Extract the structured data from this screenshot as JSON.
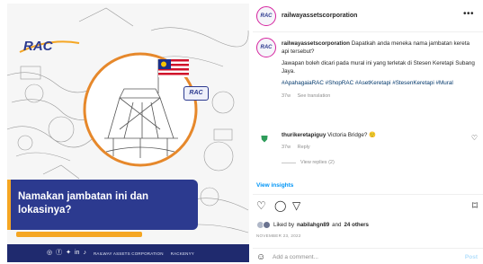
{
  "post_image": {
    "logo_text": "RAC",
    "badge_text": "RAC",
    "caption_text": "Namakan jambatan ini dan lokasinya?",
    "footer_text": "RAILWAY ASSETS CORPORATION",
    "footer_handle": "RACKENYY",
    "colors": {
      "banner": "#2c3a8f",
      "accent": "#f5a623",
      "footer": "#1f2a6e"
    }
  },
  "header": {
    "username": "railwayassetscorporation",
    "avatar_text": "RAC",
    "more_icon": "more-horizontal-icon"
  },
  "caption": {
    "username": "railwayassetscorporation",
    "line1": "Dapatkah anda meneka nama jambatan kereta api tersebut?",
    "line2": "Jawapan boleh dicari pada mural ini yang terletak di Stesen Keretapi Subang Jaya.",
    "hashtags": "#ApahagaiaRAC #ShopRAC #AsetKeretapi #StesenKeretapi #Mural",
    "age": "37w",
    "see_translation": "See translation"
  },
  "reply": {
    "username": "thurikeretapiguy",
    "text": "Victoria Bridge?",
    "emoji": "🙂",
    "age": "37w",
    "reply_label": "Reply",
    "view_replies": "View replies (2)"
  },
  "view_insights": "View insights",
  "likes": {
    "prefix": "Liked by",
    "user": "nabilahgn89",
    "connector": "and",
    "others": "24 others"
  },
  "date": "NOVEMBER 23, 2022",
  "add_comment": {
    "placeholder": "Add a comment...",
    "post_label": "Post"
  },
  "icons": {
    "like": "heart-icon",
    "comment": "comment-icon",
    "share": "share-icon",
    "save": "bookmark-icon",
    "emoji": "emoji-icon"
  }
}
